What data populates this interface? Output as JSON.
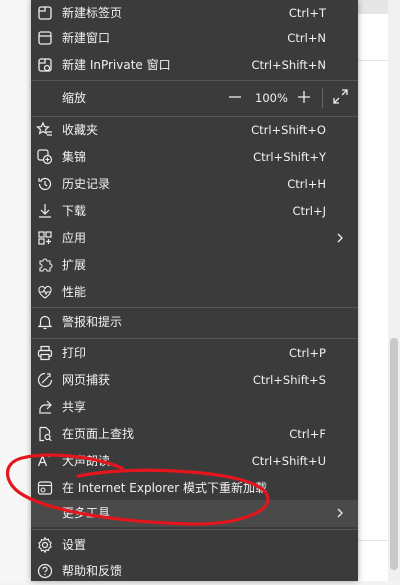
{
  "menu": {
    "items": [
      {
        "label": "新建标签页",
        "shortcut": "Ctrl+T",
        "icon": "new-tab-icon"
      },
      {
        "label": "新建窗口",
        "shortcut": "Ctrl+N",
        "icon": "new-window-icon"
      },
      {
        "label": "新建 InPrivate 窗口",
        "shortcut": "Ctrl+Shift+N",
        "icon": "inprivate-window-icon"
      },
      {
        "label": "收藏夹",
        "shortcut": "Ctrl+Shift+O",
        "icon": "favorites-icon"
      },
      {
        "label": "集锦",
        "shortcut": "Ctrl+Shift+Y",
        "icon": "collections-icon"
      },
      {
        "label": "历史记录",
        "shortcut": "Ctrl+H",
        "icon": "history-icon"
      },
      {
        "label": "下载",
        "shortcut": "Ctrl+J",
        "icon": "download-icon"
      },
      {
        "label": "应用",
        "shortcut": "",
        "icon": "apps-icon"
      },
      {
        "label": "扩展",
        "shortcut": "",
        "icon": "extensions-icon"
      },
      {
        "label": "性能",
        "shortcut": "",
        "icon": "performance-icon"
      },
      {
        "label": "警报和提示",
        "shortcut": "",
        "icon": "bell-icon"
      },
      {
        "label": "打印",
        "shortcut": "Ctrl+P",
        "icon": "print-icon"
      },
      {
        "label": "网页捕获",
        "shortcut": "Ctrl+Shift+S",
        "icon": "web-capture-icon"
      },
      {
        "label": "共享",
        "shortcut": "",
        "icon": "share-icon"
      },
      {
        "label": "在页面上查找",
        "shortcut": "Ctrl+F",
        "icon": "find-on-page-icon"
      },
      {
        "label": "大声朗读",
        "shortcut": "Ctrl+Shift+U",
        "icon": "read-aloud-icon"
      },
      {
        "label": "在 Internet Explorer 模式下重新加载",
        "shortcut": "",
        "icon": "ie-mode-icon"
      },
      {
        "label": "更多工具",
        "shortcut": "",
        "icon": ""
      },
      {
        "label": "设置",
        "shortcut": "",
        "icon": "gear-icon"
      },
      {
        "label": "帮助和反馈",
        "shortcut": "",
        "icon": "help-icon"
      }
    ],
    "zoom": {
      "label": "缩放",
      "value": "100%"
    }
  },
  "colors": {
    "menu_bg": "#3b3b3b",
    "text": "#f2f2f2",
    "annotation_red": "#e3161d"
  }
}
